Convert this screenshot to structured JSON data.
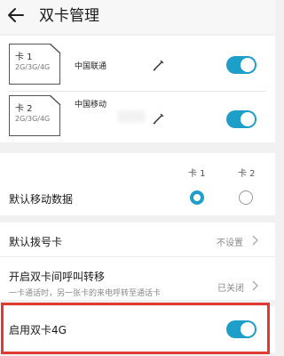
{
  "header": {
    "title": "双卡管理"
  },
  "sims": [
    {
      "name": "卡 1",
      "network": "2G/3G/4G",
      "carrier": "中国联通",
      "enabled": true
    },
    {
      "name": "卡 2",
      "network": "2G/3G/4G",
      "carrier": "中国移动",
      "enabled": true
    }
  ],
  "columns": {
    "sim1": "卡 1",
    "sim2": "卡 2"
  },
  "settings": {
    "default_data": {
      "label": "默认移动数据",
      "selected": "卡 1"
    },
    "default_dial": {
      "label": "默认拨号卡",
      "value": "不设置"
    },
    "call_forward": {
      "label": "开启双卡间呼叫转移",
      "description": "一卡通话时，另一张卡的来电呼转至通话卡",
      "value": "已关闭"
    },
    "dual_4g": {
      "label": "启用双卡4G",
      "enabled": true
    }
  },
  "colors": {
    "accent": "#1e9fc9",
    "highlight_border": "#e03a33"
  },
  "icons": [
    "back-arrow-icon",
    "sim-card-icon",
    "edit-pen-icon",
    "chevron-right-icon"
  ]
}
